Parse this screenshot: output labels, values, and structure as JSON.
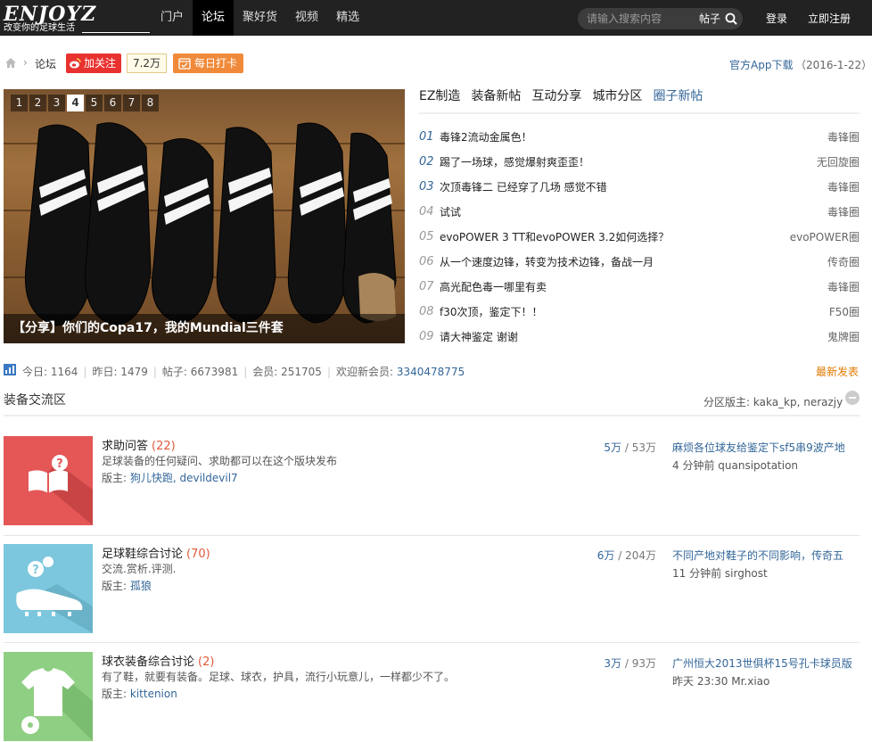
{
  "header": {
    "logo_text": "ENJOYZ",
    "logo_slogan": "改变你的足球生活",
    "nav": [
      "门户",
      "论坛",
      "聚好货",
      "视频",
      "精选"
    ],
    "active_nav": 1,
    "search_placeholder": "请输入搜索内容",
    "search_type": "帖子",
    "login": "登录",
    "register": "立即注册"
  },
  "breadcrumb": {
    "current": "论坛",
    "follow_label": "加关注",
    "fans": "7.2万",
    "checkin_label": "每日打卡",
    "app_download": "官方App下载",
    "app_date": "（2016-1-22）"
  },
  "slideshow": {
    "numbers": [
      "1",
      "2",
      "3",
      "4",
      "5",
      "6",
      "7",
      "8"
    ],
    "active": 3,
    "caption": "【分享】你们的Copa17，我的Mundial三件套"
  },
  "tabs": [
    "EZ制造",
    "装备新帖",
    "互动分享",
    "城市分区",
    "圈子新帖"
  ],
  "active_tab": 4,
  "topics": [
    {
      "num": "01",
      "title": "毒锋2流动金属色！",
      "tag": "毒锋圈"
    },
    {
      "num": "02",
      "title": "踢了一场球，感觉爆射爽歪歪！",
      "tag": "无回旋圈"
    },
    {
      "num": "03",
      "title": "次顶毒锋二 已经穿了几场 感觉不错",
      "tag": "毒锋圈"
    },
    {
      "num": "04",
      "title": "试试",
      "tag": "毒锋圈"
    },
    {
      "num": "05",
      "title": "evoPOWER 3 TT和evoPOWER 3.2如何选择？",
      "tag": "evoPOWER圈"
    },
    {
      "num": "06",
      "title": "从一个速度边锋，转变为技术边锋，备战一月",
      "tag": "传奇圈"
    },
    {
      "num": "07",
      "title": "高光配色毒一哪里有卖",
      "tag": "毒锋圈"
    },
    {
      "num": "08",
      "title": "f30次顶，鉴定下！！",
      "tag": "F50圈"
    },
    {
      "num": "09",
      "title": "请大神鉴定 谢谢",
      "tag": "鬼牌圈"
    }
  ],
  "stats": {
    "today": "今日: 1164",
    "yesterday": "昨日: 1479",
    "posts": "帖子: 6673981",
    "members": "会员: 251705",
    "welcome": "欢迎新会员:",
    "new_member": "3340478775",
    "new_post": "最新发表"
  },
  "section": {
    "title": "装备交流区",
    "moderators": "分区版主: kaka_kp, nerazjy"
  },
  "forums": [
    {
      "name": "求助问答",
      "count": "(22)",
      "desc": "足球装备的任何疑问、求助都可以在这个版块发布",
      "mods_label": "版主:",
      "mods": "狗儿快跑, devildevil7",
      "threads": "5万",
      "posts": "53万",
      "last_title": "麻烦各位球友给鉴定下sf5串9波产地",
      "last_meta": "4 分钟前 quansipotation",
      "color": "#e55757"
    },
    {
      "name": "足球鞋综合讨论",
      "count": "(70)",
      "desc": "交流.赏析.评测.",
      "mods_label": "版主:",
      "mods": "孤狼",
      "threads": "6万",
      "posts": "204万",
      "last_title": "不同产地对鞋子的不同影响，传奇五",
      "last_meta": "11 分钟前 sirghost",
      "color": "#7cc7dd"
    },
    {
      "name": "球衣装备综合讨论",
      "count": "(2)",
      "desc": "有了鞋，就要有装备。足球、球衣，护具，流行小玩意儿，一样都少不了。",
      "mods_label": "版主:",
      "mods": "kittenion",
      "threads": "3万",
      "posts": "93万",
      "last_title": "广州恒大2013世俱杯15号孔卡球员版",
      "last_meta": "昨天 23:30 Mr.xiao",
      "color": "#8fcf83"
    }
  ]
}
